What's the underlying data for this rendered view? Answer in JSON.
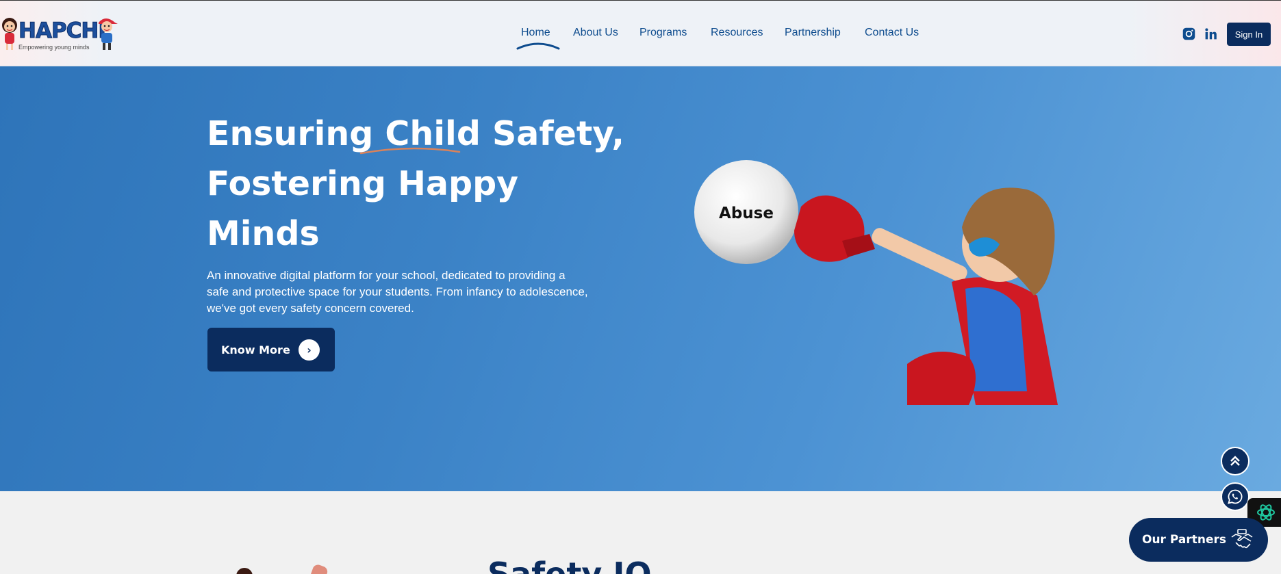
{
  "header": {
    "logo_text": "HAPCHI",
    "logo_tagline": "Empowering young minds",
    "nav": [
      {
        "label": "Home",
        "active": true
      },
      {
        "label": "About Us"
      },
      {
        "label": "Programs"
      },
      {
        "label": "Resources"
      },
      {
        "label": "Partnership"
      },
      {
        "label": "Contact Us"
      }
    ],
    "social_icons": [
      "instagram-icon",
      "linkedin-icon"
    ],
    "signin_label": "Sign In"
  },
  "hero": {
    "title_line1a": "Ensuring ",
    "title_line1b": "Child",
    "title_line1c": " Safety,",
    "title_line2": "Fostering Happy",
    "title_line3": "Minds",
    "description": "An innovative digital platform for your school, dedicated to providing a safe and protective space for your students. From infancy to adolescence, we've got every safety concern covered.",
    "cta_label": "Know More",
    "cta_arrow": "›",
    "image_ball_text": "Abuse"
  },
  "floating": {
    "scroll_top_icon": "double-chevron-up-icon",
    "whatsapp_icon": "whatsapp-icon",
    "ai_icon": "openai-icon",
    "partners_label": "Our Partners",
    "partners_icon": "handshake-icon"
  },
  "next_section": {
    "title": "Safety IQ"
  },
  "colors": {
    "navy": "#0b2c5e",
    "nav_text": "#0e4c8e",
    "hero_start": "#2e74b9",
    "hero_end": "#6aaae0",
    "underline_accent": "#d9825b"
  }
}
